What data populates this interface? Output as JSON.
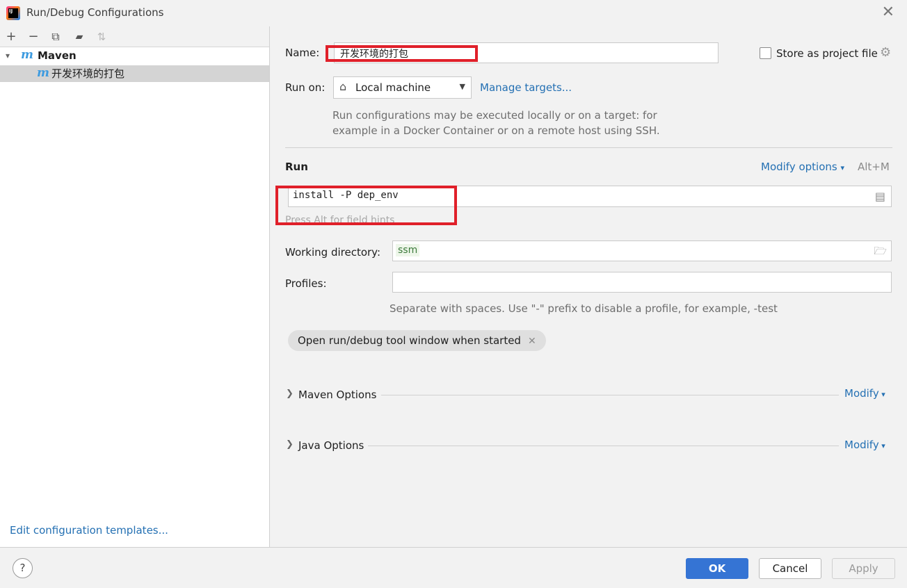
{
  "window": {
    "title": "Run/Debug Configurations",
    "app_icon_text": "IJ"
  },
  "toolbar": {
    "add": "+",
    "remove": "−",
    "copy": "⧉",
    "folder": "▰",
    "sort": "⇅"
  },
  "tree": {
    "group": {
      "icon": "m",
      "label": "Maven"
    },
    "item": {
      "icon": "m",
      "label": "开发环境的打包"
    }
  },
  "left_footer": {
    "edit_templates": "Edit configuration templates..."
  },
  "form": {
    "name_label": "Name:",
    "name_value": "开发环境的打包",
    "store_label": "Store as project file",
    "run_on_label": "Run on:",
    "run_on_value": "Local machine",
    "manage_targets": "Manage targets...",
    "run_on_hint_1": "Run configurations may be executed locally or on a target: for",
    "run_on_hint_2": "example in a Docker Container or on a remote host using SSH.",
    "run_section": "Run",
    "modify_options": "Modify options",
    "modify_shortcut": "Alt+M",
    "command_value": "install -P dep_env",
    "command_hint": "Press Alt for field hints",
    "working_dir_label": "Working directory:",
    "working_dir_value": "ssm",
    "profiles_label": "Profiles:",
    "profiles_value": "",
    "profiles_hint": "Separate with spaces. Use \"-\" prefix to disable a profile, for example, -test",
    "chip_label": "Open run/debug tool window when started",
    "maven_options": "Maven Options",
    "java_options": "Java Options",
    "modify": "Modify"
  },
  "buttons": {
    "help": "?",
    "ok": "OK",
    "cancel": "Cancel",
    "apply": "Apply"
  }
}
